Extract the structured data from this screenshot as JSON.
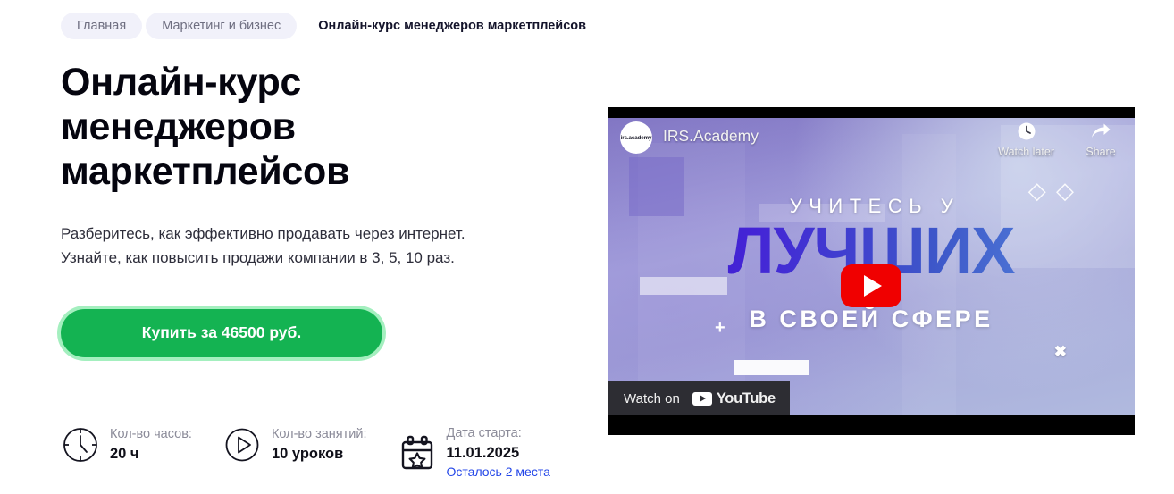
{
  "breadcrumb": {
    "items": [
      {
        "label": "Главная",
        "current": false
      },
      {
        "label": "Маркетинг и бизнес",
        "current": false
      },
      {
        "label": "Онлайн-курс менеджеров маркетплейсов",
        "current": true
      }
    ]
  },
  "hero": {
    "title": "Онлайн-курс менеджеров маркетплейсов",
    "subtitle_line1": "Разберитесь, как эффективно продавать через интернет.",
    "subtitle_line2": "Узнайте, как повысить продажи компании в 3, 5, 10 раз.",
    "cta_label": "Купить за 46500 руб.",
    "cta_color": "#14b352",
    "cta_glow": "#5ae28a"
  },
  "info": [
    {
      "icon": "clock-icon",
      "label": "Кол-во часов:",
      "value": "20 ч",
      "extra": ""
    },
    {
      "icon": "play-circle-icon",
      "label": "Кол-во занятий:",
      "value": "10 уроков",
      "extra": ""
    },
    {
      "icon": "calendar-star-icon",
      "label": "Дата старта:",
      "value": "11.01.2025",
      "extra": "Осталось 2 места",
      "extra_color": "#2346e8"
    }
  ],
  "video": {
    "avatar_text": "irs.academy",
    "channel": "IRS.Academy",
    "watch_later": "Watch later",
    "share": "Share",
    "headline1": "УЧИТЕСЬ У",
    "headline2": "ЛУЧШИХ",
    "headline3": "В СВОЕЙ СФЕРЕ",
    "plus_mark": "+",
    "glyphs": "◇ ◇",
    "watch_on": "Watch on",
    "youtube": "YouTube",
    "close": "✖",
    "play_color": "#f00000"
  }
}
